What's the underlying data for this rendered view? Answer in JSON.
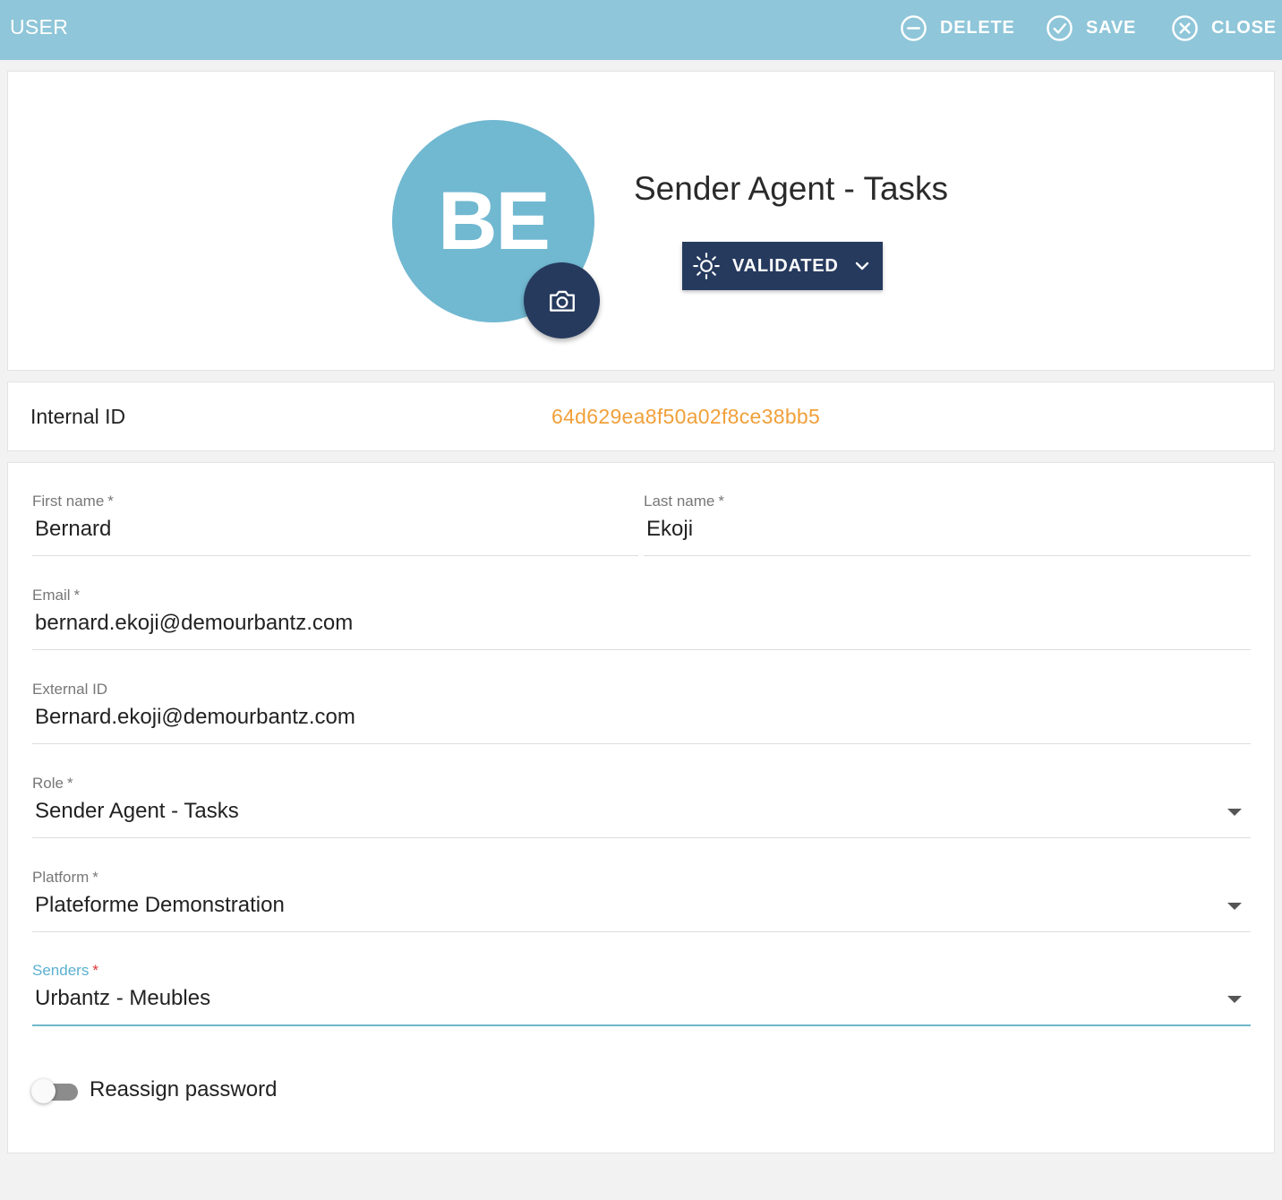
{
  "header": {
    "title": "USER",
    "actions": {
      "delete_label": "DELETE",
      "save_label": "SAVE",
      "close_label": "CLOSE"
    }
  },
  "profile": {
    "initials": "BE",
    "role_title": "Sender Agent - Tasks",
    "status_label": "VALIDATED",
    "avatar_color": "#71b8d1",
    "accent_color": "#263a5e"
  },
  "internal": {
    "label": "Internal ID",
    "value": "64d629ea8f50a02f8ce38bb5",
    "value_color": "#f0a03a"
  },
  "form": {
    "first_name": {
      "label": "First name",
      "required": "*",
      "value": "Bernard"
    },
    "last_name": {
      "label": "Last name",
      "required": "*",
      "value": "Ekoji"
    },
    "email": {
      "label": "Email",
      "required": "*",
      "value": "bernard.ekoji@demourbantz.com"
    },
    "external_id": {
      "label": "External ID",
      "value": "Bernard.ekoji@demourbantz.com"
    },
    "role": {
      "label": "Role",
      "required": "*",
      "value": "Sender Agent - Tasks"
    },
    "platform": {
      "label": "Platform",
      "required": "*",
      "value": "Plateforme Demonstration"
    },
    "senders": {
      "label": "Senders",
      "required": "*",
      "value": "Urbantz - Meubles"
    },
    "reassign_password": {
      "label": "Reassign password",
      "enabled": false
    }
  },
  "icons": {
    "delete": "minus-circle-icon",
    "save": "check-circle-icon",
    "close": "x-circle-icon",
    "camera": "camera-icon",
    "status": "sun-icon",
    "dropdown": "chevron-down-icon"
  }
}
